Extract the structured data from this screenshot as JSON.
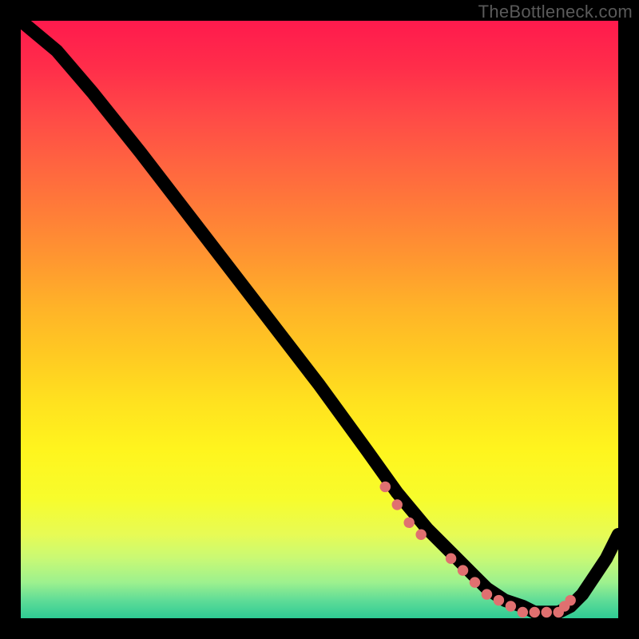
{
  "watermark": "TheBottleneck.com",
  "chart_data": {
    "type": "line",
    "title": "",
    "xlabel": "",
    "ylabel": "",
    "xlim": [
      0,
      100
    ],
    "ylim": [
      0,
      100
    ],
    "background_gradient": {
      "orientation": "vertical",
      "stops": [
        {
          "pos": 0.0,
          "color": "#ff1a4d"
        },
        {
          "pos": 0.5,
          "color": "#ffca22"
        },
        {
          "pos": 0.8,
          "color": "#fff51e"
        },
        {
          "pos": 1.0,
          "color": "#2ecb94"
        }
      ]
    },
    "series": [
      {
        "name": "bottleneck-curve",
        "x": [
          0,
          6,
          12,
          20,
          30,
          40,
          50,
          58,
          63,
          68,
          72,
          74,
          76,
          78,
          81,
          84,
          86,
          88,
          90,
          92,
          94,
          96,
          98,
          100
        ],
        "y": [
          100,
          95,
          88,
          78,
          65,
          52,
          39,
          28,
          21,
          15,
          11,
          9,
          7,
          5,
          3,
          2,
          1,
          1,
          1,
          2,
          4,
          7,
          10,
          14
        ]
      }
    ],
    "markers": {
      "name": "highlight-points",
      "x": [
        61,
        63,
        65,
        67,
        72,
        74,
        76,
        78,
        80,
        82,
        84,
        86,
        88,
        90,
        91,
        92
      ],
      "y": [
        22,
        19,
        16,
        14,
        10,
        8,
        6,
        4,
        3,
        2,
        1,
        1,
        1,
        1,
        2,
        3
      ],
      "color": "#e07070",
      "size": 5
    }
  }
}
